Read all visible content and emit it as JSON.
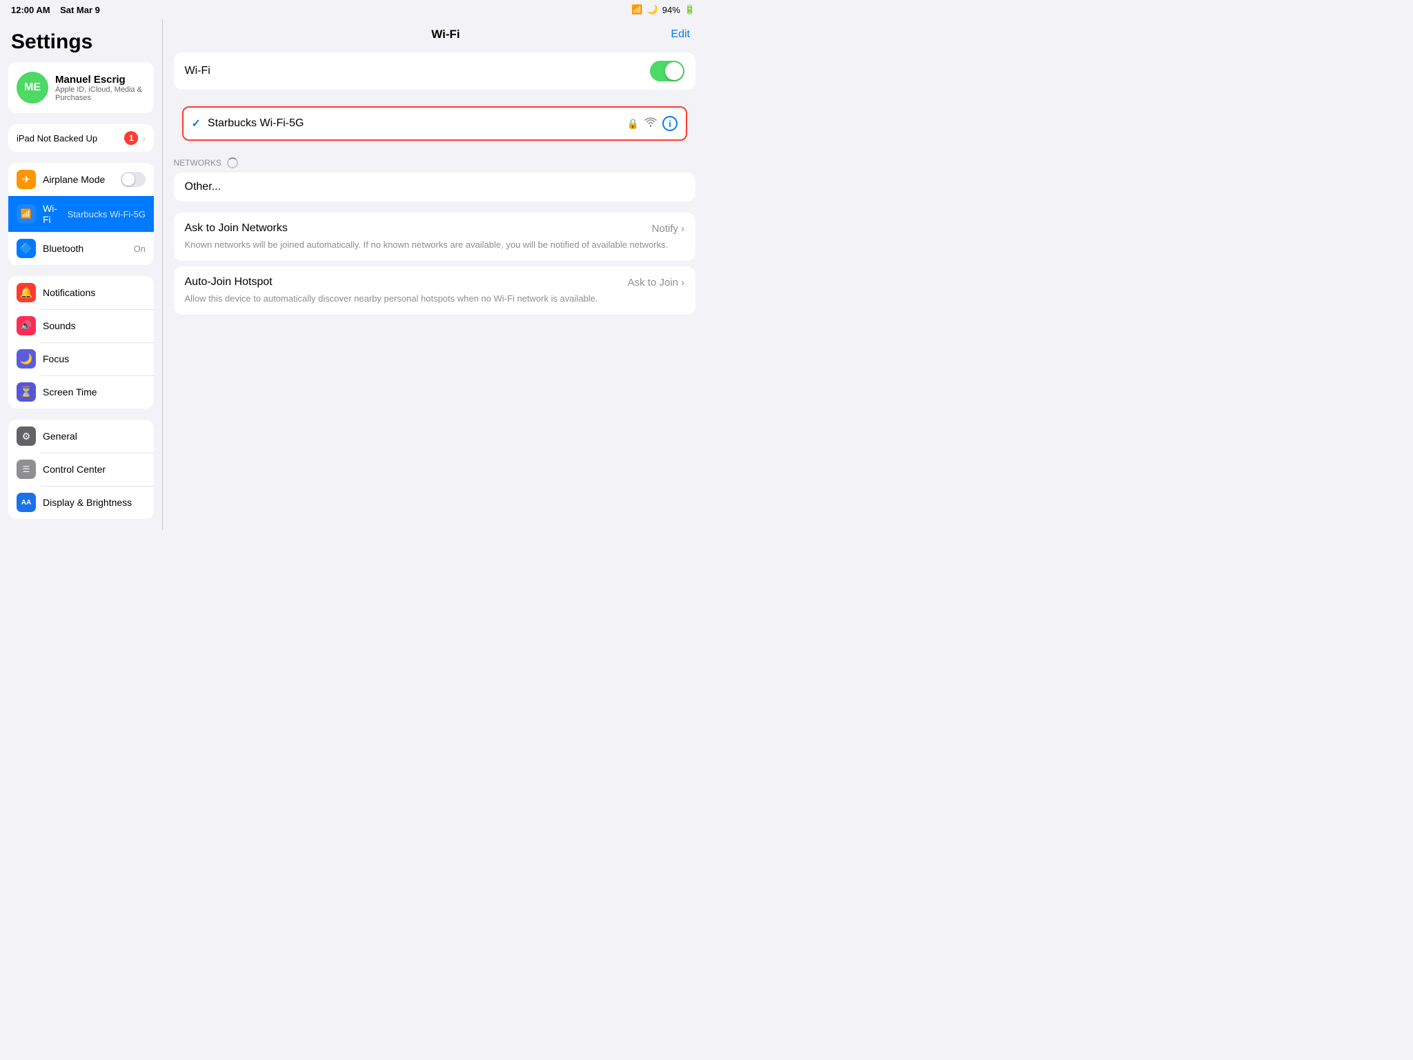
{
  "statusBar": {
    "time": "12:00 AM",
    "date": "Sat Mar 9",
    "battery": "94%"
  },
  "sidebar": {
    "title": "Settings",
    "profile": {
      "initials": "ME",
      "name": "Manuel Escrig",
      "subtitle": "Apple ID, iCloud, Media & Purchases"
    },
    "backup": {
      "text": "iPad Not Backed Up",
      "badge": "1"
    },
    "group1": [
      {
        "id": "airplane",
        "label": "Airplane Mode",
        "icon": "✈",
        "bgClass": "bg-orange",
        "hasToggle": true
      },
      {
        "id": "wifi",
        "label": "Wi-Fi",
        "icon": "📶",
        "bgClass": "bg-blue2",
        "value": "Starbucks Wi-Fi-5G",
        "active": true
      },
      {
        "id": "bluetooth",
        "label": "Bluetooth",
        "icon": "🔵",
        "bgClass": "bg-blue",
        "value": "On"
      }
    ],
    "group2": [
      {
        "id": "notifications",
        "label": "Notifications",
        "icon": "🔔",
        "bgClass": "bg-red"
      },
      {
        "id": "sounds",
        "label": "Sounds",
        "icon": "🔊",
        "bgClass": "bg-pink"
      },
      {
        "id": "focus",
        "label": "Focus",
        "icon": "🌙",
        "bgClass": "bg-indigo"
      },
      {
        "id": "screentime",
        "label": "Screen Time",
        "icon": "⏳",
        "bgClass": "bg-purple"
      }
    ],
    "group3": [
      {
        "id": "general",
        "label": "General",
        "icon": "⚙",
        "bgClass": "bg-gray2"
      },
      {
        "id": "controlcenter",
        "label": "Control Center",
        "icon": "☰",
        "bgClass": "bg-gray"
      },
      {
        "id": "displaybrightness",
        "label": "Display & Brightness",
        "icon": "AA",
        "bgClass": "bg-aa"
      }
    ]
  },
  "content": {
    "title": "Wi-Fi",
    "editButton": "Edit",
    "wifiLabel": "Wi-Fi",
    "wifiOn": true,
    "connectedNetwork": {
      "name": "Starbucks Wi-Fi-5G",
      "locked": true,
      "signal": "full"
    },
    "networksHeader": "NETWORKS",
    "otherLabel": "Other...",
    "askToJoin": {
      "label": "Ask to Join Networks",
      "value": "Notify",
      "description": "Known networks will be joined automatically. If no known networks are available, you will be notified of available networks."
    },
    "autoJoin": {
      "label": "Auto-Join Hotspot",
      "value": "Ask to Join",
      "description": "Allow this device to automatically discover nearby personal hotspots when no Wi-Fi network is available."
    }
  }
}
